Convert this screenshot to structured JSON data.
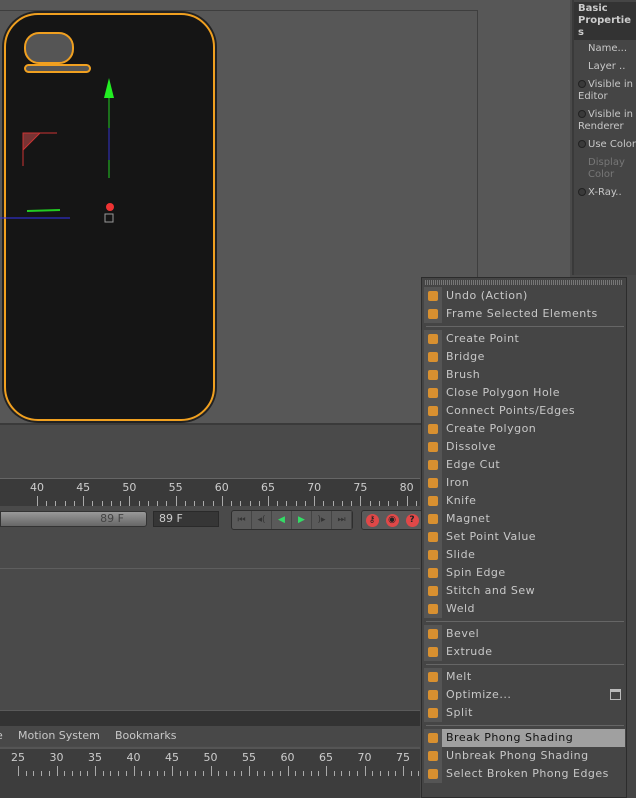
{
  "properties": {
    "title": "Basic Properties",
    "rows": [
      {
        "label": "Name...",
        "dot": false
      },
      {
        "label": "Layer ..",
        "dot": false
      },
      {
        "label": "Visible in Editor",
        "dot": true
      },
      {
        "label": "Visible in Renderer",
        "dot": true
      },
      {
        "label": "Use Color",
        "dot": true
      },
      {
        "label": "Display Color",
        "dot": false,
        "dim": true
      },
      {
        "label": "X-Ray..",
        "dot": true
      }
    ]
  },
  "timeline": {
    "ticks": [
      40,
      45,
      50,
      55,
      60,
      65,
      70,
      75,
      80
    ],
    "slider_value": "89 F",
    "frame_field": "89 F",
    "transport": [
      "go-to-start",
      "step-back",
      "play-backward",
      "play-forward",
      "step-forward",
      "go-to-end"
    ],
    "record_buttons": [
      "record-key",
      "auto-key",
      "help"
    ]
  },
  "bottom_menu": [
    "e",
    "Motion System",
    "Bookmarks"
  ],
  "bottom_ruler_ticks": [
    25,
    30,
    35,
    40,
    45,
    50,
    55,
    60,
    65,
    70,
    75
  ],
  "menu": {
    "accent": "#f0a020",
    "items": [
      {
        "label": "Undo (Action)",
        "icon": "undo-icon"
      },
      {
        "label": "Frame Selected Elements",
        "icon": "frame-icon",
        "sep_after": true
      },
      {
        "label": "Create Point",
        "icon": "create-point-icon"
      },
      {
        "label": "Bridge",
        "icon": "bridge-icon"
      },
      {
        "label": "Brush",
        "icon": "brush-icon"
      },
      {
        "label": "Close Polygon Hole",
        "icon": "close-hole-icon"
      },
      {
        "label": "Connect Points/Edges",
        "icon": "connect-icon"
      },
      {
        "label": "Create Polygon",
        "icon": "create-polygon-icon"
      },
      {
        "label": "Dissolve",
        "icon": "dissolve-icon"
      },
      {
        "label": "Edge Cut",
        "icon": "edge-cut-icon"
      },
      {
        "label": "Iron",
        "icon": "iron-icon"
      },
      {
        "label": "Knife",
        "icon": "knife-icon"
      },
      {
        "label": "Magnet",
        "icon": "magnet-icon"
      },
      {
        "label": "Set Point Value",
        "icon": "set-point-icon"
      },
      {
        "label": "Slide",
        "icon": "slide-icon"
      },
      {
        "label": "Spin Edge",
        "icon": "spin-edge-icon"
      },
      {
        "label": "Stitch and Sew",
        "icon": "stitch-icon"
      },
      {
        "label": "Weld",
        "icon": "weld-icon",
        "sep_after": true
      },
      {
        "label": "Bevel",
        "icon": "bevel-icon"
      },
      {
        "label": "Extrude",
        "icon": "extrude-icon",
        "sep_after": true
      },
      {
        "label": "Melt",
        "icon": "melt-icon"
      },
      {
        "label": "Optimize...",
        "icon": "optimize-icon",
        "options": true
      },
      {
        "label": "Split",
        "icon": "split-icon",
        "sep_after": true
      },
      {
        "label": "Break Phong Shading",
        "icon": "break-phong-icon",
        "highlighted": true
      },
      {
        "label": "Unbreak Phong Shading",
        "icon": "unbreak-phong-icon"
      },
      {
        "label": "Select Broken Phong Edges",
        "icon": "select-phong-icon"
      }
    ]
  }
}
